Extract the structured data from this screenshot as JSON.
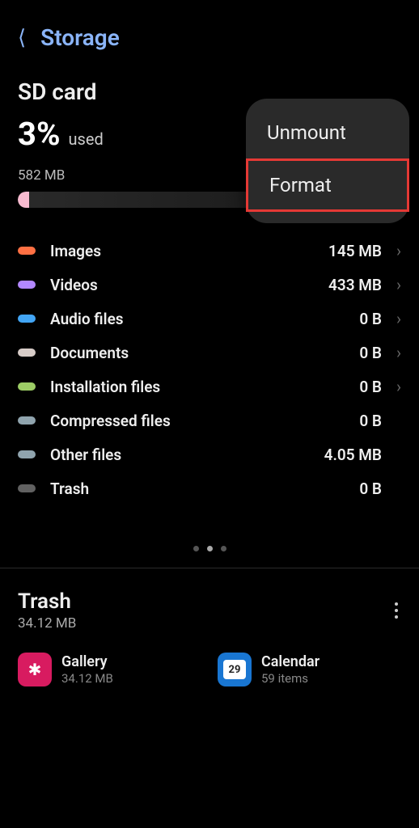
{
  "header": {
    "title": "Storage"
  },
  "sd_card": {
    "title": "SD card",
    "percent": "3%",
    "used_label": "used",
    "total": "582 MB"
  },
  "categories": [
    {
      "label": "Images",
      "value": "145 MB",
      "color": "#ff7043",
      "chevron": true
    },
    {
      "label": "Videos",
      "value": "433 MB",
      "color": "#b388ff",
      "chevron": true
    },
    {
      "label": "Audio files",
      "value": "0 B",
      "color": "#42a5f5",
      "chevron": true
    },
    {
      "label": "Documents",
      "value": "0 B",
      "color": "#d7ccc8",
      "chevron": true
    },
    {
      "label": "Installation files",
      "value": "0 B",
      "color": "#9ccc65",
      "chevron": true
    },
    {
      "label": "Compressed files",
      "value": "0 B",
      "color": "#90a4ae",
      "chevron": false
    },
    {
      "label": "Other files",
      "value": "4.05 MB",
      "color": "#90a4ae",
      "chevron": false
    },
    {
      "label": "Trash",
      "value": "0 B",
      "color": "#616161",
      "chevron": false
    }
  ],
  "popup": {
    "unmount": "Unmount",
    "format": "Format"
  },
  "trash": {
    "title": "Trash",
    "size": "34.12 MB",
    "apps": [
      {
        "name": "Gallery",
        "sub": "34.12 MB",
        "icon": "gallery"
      },
      {
        "name": "Calendar",
        "sub": "59 items",
        "icon": "calendar",
        "day": "29"
      }
    ]
  }
}
